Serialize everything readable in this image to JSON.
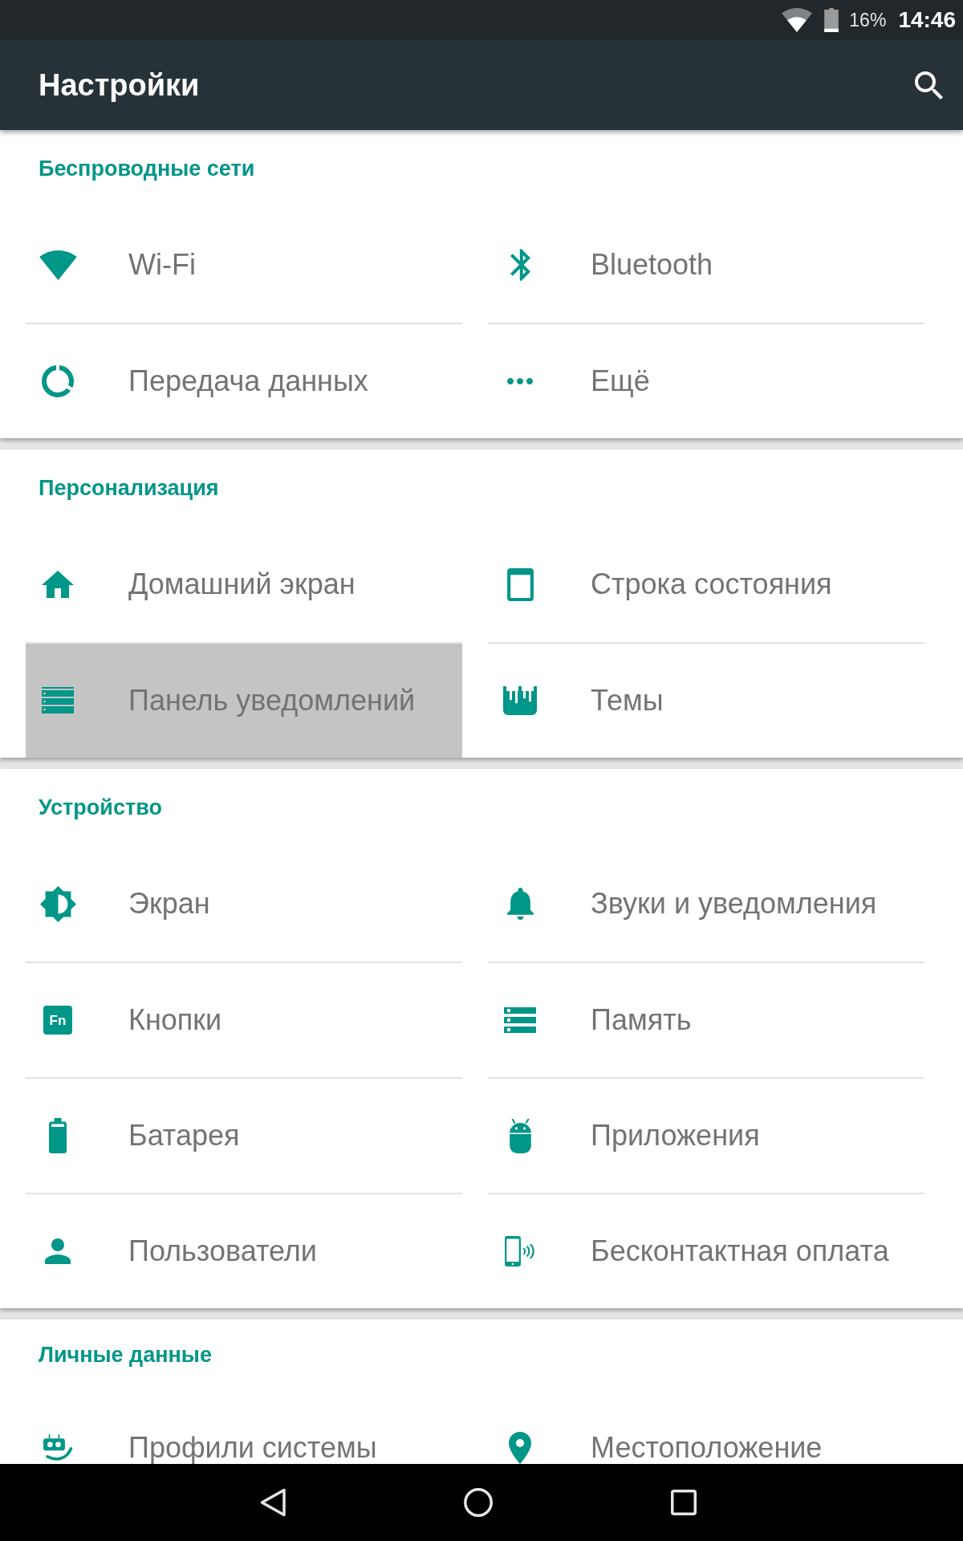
{
  "status_bar": {
    "battery": "16%",
    "time": "14:46"
  },
  "app_bar": {
    "title": "Настройки"
  },
  "sections": [
    {
      "title": "Беспроводные сети",
      "items": [
        {
          "label": "Wi-Fi",
          "selected": false
        },
        {
          "label": "Bluetooth",
          "selected": false
        },
        {
          "label": "Передача данных",
          "selected": false
        },
        {
          "label": "Ещё",
          "selected": false
        }
      ]
    },
    {
      "title": "Персонализация",
      "items": [
        {
          "label": "Домашний экран",
          "selected": false
        },
        {
          "label": "Строка состояния",
          "selected": false
        },
        {
          "label": "Панель уведомлений",
          "selected": true
        },
        {
          "label": "Темы",
          "selected": false
        }
      ]
    },
    {
      "title": "Устройство",
      "items": [
        {
          "label": "Экран",
          "selected": false
        },
        {
          "label": "Звуки и уведомления",
          "selected": false
        },
        {
          "label": "Кнопки",
          "selected": false,
          "icon_text": "Fn"
        },
        {
          "label": "Память",
          "selected": false
        },
        {
          "label": "Батарея",
          "selected": false
        },
        {
          "label": "Приложения",
          "selected": false
        },
        {
          "label": "Пользователи",
          "selected": false
        },
        {
          "label": "Бесконтактная оплата",
          "selected": false
        }
      ]
    },
    {
      "title": "Личные данные",
      "items": [
        {
          "label": "Профили системы",
          "selected": false
        },
        {
          "label": "Местоположение",
          "selected": false
        }
      ]
    }
  ]
}
